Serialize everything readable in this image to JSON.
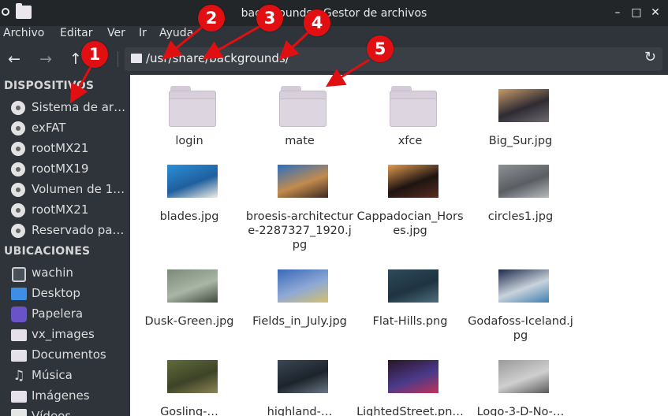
{
  "window": {
    "title": "backgrounds - Gestor de archivos",
    "controls": {
      "minimize": "–",
      "maximize": "□",
      "close": "✕"
    }
  },
  "menu": [
    "Archivo",
    "Editar",
    "Ver",
    "Ir",
    "Ayuda"
  ],
  "toolbar": {
    "back": "←",
    "forward": "→",
    "up": "↑",
    "path": "/usr/share/backgrounds/",
    "reload": "↻"
  },
  "sidebar": {
    "devices_header": "DISPOSITIVOS",
    "devices": [
      {
        "label": "Sistema de ar…",
        "icon": "disk-icon"
      },
      {
        "label": "exFAT",
        "icon": "disk-icon"
      },
      {
        "label": "rootMX21",
        "icon": "disk-icon"
      },
      {
        "label": "rootMX19",
        "icon": "disk-icon"
      },
      {
        "label": "Volumen de 1…",
        "icon": "disk-icon"
      },
      {
        "label": "rootMX21",
        "icon": "disk-icon"
      },
      {
        "label": "Reservado pa…",
        "icon": "disk-icon"
      }
    ],
    "places_header": "UBICACIONES",
    "places": [
      {
        "label": "wachin",
        "icon": "home-icon"
      },
      {
        "label": "Desktop",
        "icon": "desktop-icon"
      },
      {
        "label": "Papelera",
        "icon": "trash-icon"
      },
      {
        "label": "vx_images",
        "icon": "folder-icon"
      },
      {
        "label": "Documentos",
        "icon": "folder-icon"
      },
      {
        "label": "Música",
        "icon": "music-icon"
      },
      {
        "label": "Imágenes",
        "icon": "folder-icon"
      },
      {
        "label": "Vídeos",
        "icon": "video-icon"
      }
    ]
  },
  "files": [
    {
      "name": "login",
      "type": "folder"
    },
    {
      "name": "mate",
      "type": "folder"
    },
    {
      "name": "xfce",
      "type": "folder"
    },
    {
      "name": "Big_Sur.jpg",
      "type": "image",
      "colors": [
        "#c79a6a",
        "#6e6a6f",
        "#2e2b33"
      ]
    },
    {
      "name": "blades.jpg",
      "type": "image",
      "colors": [
        "#2c8fd8",
        "#f1efe4",
        "#1f5f9e"
      ]
    },
    {
      "name": "broesis-architecture-2287327_1920.jpg",
      "type": "image",
      "colors": [
        "#2a6fc0",
        "#3a2a22",
        "#c28b4e"
      ]
    },
    {
      "name": "Cappadocian_Horses.jpg",
      "type": "image",
      "colors": [
        "#e39a52",
        "#5a2e22",
        "#1e1411"
      ]
    },
    {
      "name": "circles1.jpg",
      "type": "image",
      "colors": [
        "#8d9094",
        "#b7babd",
        "#5a5e63"
      ]
    },
    {
      "name": "Dusk-Green.jpg",
      "type": "image",
      "colors": [
        "#7b8a78",
        "#3f4a3e",
        "#a9b5a5"
      ]
    },
    {
      "name": "Fields_in_July.jpg",
      "type": "image",
      "colors": [
        "#3a69b8",
        "#d4c06a",
        "#8fa9d6"
      ]
    },
    {
      "name": "Flat-Hills.png",
      "type": "image",
      "colors": [
        "#2d4a5b",
        "#4c6e7d",
        "#1f3340"
      ]
    },
    {
      "name": "Godafoss-Iceland.jpg",
      "type": "image",
      "colors": [
        "#1d2a4a",
        "#3f7fb0",
        "#c9d3dc"
      ]
    },
    {
      "name": "Gosling-…",
      "type": "image",
      "colors": [
        "#5f6b3a",
        "#8d8455",
        "#3d4327"
      ]
    },
    {
      "name": "highland-…",
      "type": "image",
      "colors": [
        "#3a4755",
        "#6a7886",
        "#1c232b"
      ]
    },
    {
      "name": "LightedStreet.pn…",
      "type": "image",
      "colors": [
        "#2a1426",
        "#c0335a",
        "#4a3a8a"
      ]
    },
    {
      "name": "Logo-3-D-No-…",
      "type": "image",
      "colors": [
        "#9a9a9a",
        "#5a5a5a",
        "#cfcfcf"
      ]
    }
  ],
  "annotations": [
    "1",
    "2",
    "3",
    "4",
    "5"
  ],
  "colors": {
    "marker": "#e10f12",
    "sidebar": "#2f343a",
    "titlebar": "#232629"
  }
}
